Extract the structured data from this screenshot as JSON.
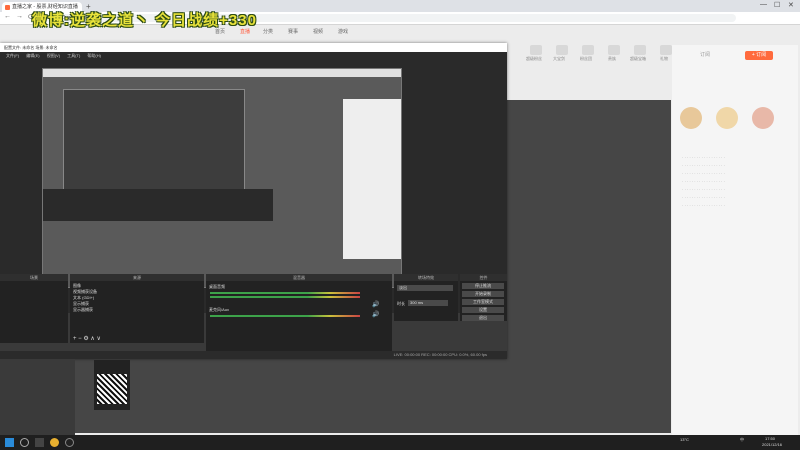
{
  "browser": {
    "tab_title": "直播之家 - 股票,财经知识直播",
    "new_tab": "+",
    "url": "www.huya.com/",
    "nav_back": "←",
    "nav_forward": "→",
    "nav_refresh": "⟳",
    "win_min": "—",
    "win_max": "☐",
    "win_close": "✕"
  },
  "overlay": {
    "title": "微博:逆袭之道丶 今日战绩+330"
  },
  "site": {
    "nav_items": [
      "首页",
      "直播",
      "分类",
      "赛事",
      "视频",
      "游戏",
      "消息"
    ],
    "active_nav": "直播",
    "follow_label": "+ 订阅",
    "follow_count": "订阅",
    "gifts": [
      "超级粉丝",
      "大宝剑",
      "粉丝团",
      "贵族",
      "超级宝箱",
      "礼物",
      "更多"
    ]
  },
  "obs": {
    "title": "配置文件: 未命名  场景: 未命名",
    "menu": [
      "文件(F)",
      "编辑(E)",
      "视图(V)",
      "工具(T)",
      "帮助(H)"
    ],
    "panels": {
      "scenes": "场景",
      "sources": "来源",
      "mixer": "混音器",
      "transitions": "转场特效",
      "controls": "控件"
    },
    "sources": [
      "图像",
      "视频捕获设备",
      "文本 (GDI+)",
      "显示捕获",
      "显示器捕获"
    ],
    "mixer": {
      "channel1": "桌面音频",
      "channel2": "麦克风/Aux"
    },
    "transition": {
      "type": "淡出",
      "duration_label": "时长",
      "duration": "300 ms"
    },
    "controls": [
      "停止推流",
      "开始录制",
      "工作室模式",
      "设置",
      "退出"
    ],
    "status": "LIVE: 00:00:00   REC: 00:00:00   CPU: 0.0%, 60.00 fps"
  },
  "taskbar": {
    "weather": "13°C",
    "time": "17:50",
    "date": "2021/12/16",
    "lang": "中"
  },
  "colors": {
    "accent": "#ff6a3d",
    "overlay_text": "#e8e23a",
    "overlay_outline": "#2b4a12"
  }
}
